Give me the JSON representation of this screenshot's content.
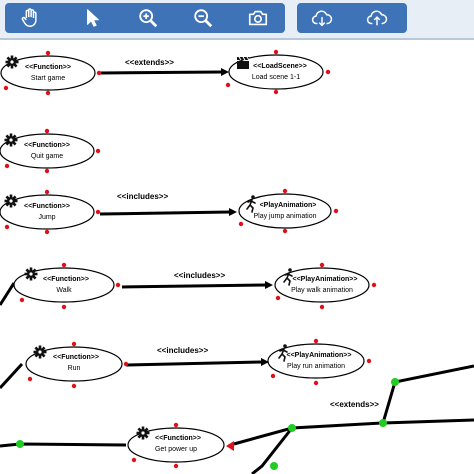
{
  "toolbar": {
    "tools": [
      {
        "icon": "hand-icon",
        "name": "pan-tool"
      },
      {
        "icon": "pointer-icon",
        "name": "select-tool"
      },
      {
        "icon": "zoom-in-icon",
        "name": "zoom-in-tool"
      },
      {
        "icon": "zoom-out-icon",
        "name": "zoom-out-tool"
      },
      {
        "icon": "camera-icon",
        "name": "snapshot-tool"
      },
      {
        "icon": "cloud-download-icon",
        "name": "download-tool"
      },
      {
        "icon": "cloud-upload-icon",
        "name": "upload-tool"
      }
    ],
    "colors": {
      "bar": "#e8eef5",
      "group": "#3f73b8",
      "icon": "#ffffff"
    }
  },
  "diagram": {
    "nodes": {
      "start_game": {
        "stereotype": "<<Function>>",
        "label": "Start game"
      },
      "load_scene": {
        "stereotype": "<<LoadScene>>",
        "label": "Load scene 1-1"
      },
      "quit_game": {
        "stereotype": "<<Function>>",
        "label": "Quit game"
      },
      "jump": {
        "stereotype": "<<Function>>",
        "label": "Jump"
      },
      "play_jump": {
        "stereotype": "<PlayAnimation>",
        "label": "Play jump animation"
      },
      "walk": {
        "stereotype": "<<Function>>",
        "label": "Walk"
      },
      "play_walk": {
        "stereotype": "<<PlayAnimation>>",
        "label": "Play walk animation"
      },
      "run": {
        "stereotype": "<<Function>>",
        "label": "Run"
      },
      "play_run": {
        "stereotype": "<<PlayAnimation>>",
        "label": "Play run animation"
      },
      "get_power_up": {
        "stereotype": "<<Function>>",
        "label": "Get power up"
      }
    },
    "relations": {
      "extends_1": "<<extends>>",
      "includes_1": "<<includes>>",
      "includes_2": "<<includes>>",
      "includes_3": "<<includes>>",
      "extends_2": "<<extends>>"
    },
    "colors": {
      "handle": "#e0101a",
      "waypoint": "#22cc22",
      "line": "#000000"
    }
  }
}
